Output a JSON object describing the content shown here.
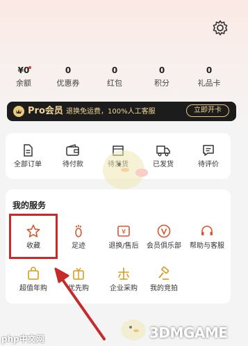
{
  "stats": [
    {
      "value": "¥0",
      "label": "余额",
      "has_dot": true
    },
    {
      "value": "0",
      "label": "优惠券"
    },
    {
      "value": "0",
      "label": "红包"
    },
    {
      "value": "0",
      "label": "积分"
    },
    {
      "value": "0",
      "label": "礼品卡"
    }
  ],
  "pro_banner": {
    "title": "Pro会员",
    "description": "退换免运费，100%人工客服",
    "button": "立即开卡"
  },
  "orders": [
    {
      "label": "全部订单",
      "icon": "order-list-icon"
    },
    {
      "label": "待付款",
      "icon": "wallet-icon"
    },
    {
      "label": "待发货",
      "icon": "package-icon"
    },
    {
      "label": "已发货",
      "icon": "truck-icon"
    },
    {
      "label": "待评价",
      "icon": "comment-icon"
    }
  ],
  "services": {
    "title": "我的服务",
    "items": [
      {
        "label": "收藏",
        "icon": "star-icon"
      },
      {
        "label": "足迹",
        "icon": "footprint-icon"
      },
      {
        "label": "退换/售后",
        "icon": "return-icon"
      },
      {
        "label": "会员俱乐部",
        "icon": "vip-icon"
      },
      {
        "label": "帮助与客服",
        "icon": "headset-icon"
      },
      {
        "label": "超值年购",
        "icon": "bag-icon"
      },
      {
        "label": "优先购",
        "icon": "gift-icon"
      },
      {
        "label": "企业采购",
        "icon": "enterprise-icon"
      },
      {
        "label": "我的竞拍",
        "icon": "auction-icon"
      }
    ]
  },
  "watermark": {
    "left": "php中文网",
    "right": "3DMGAME"
  },
  "colors": {
    "accent": "#d9542f",
    "highlight": "#c62b2b",
    "gold": "#e9c97a"
  }
}
